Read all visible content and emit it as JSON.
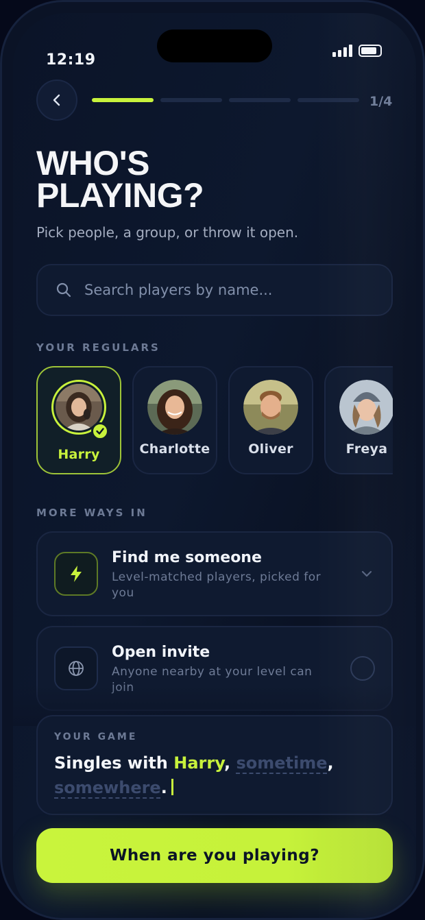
{
  "status_bar": {
    "time": "12:19"
  },
  "header": {
    "step": "1/4",
    "progress_total": 4,
    "progress_current": 1
  },
  "page": {
    "title_line1": "WHO'S",
    "title_line2": "PLAYING?",
    "subtitle": "Pick people, a group, or throw it open."
  },
  "search": {
    "placeholder": "Search players by name..."
  },
  "regulars": {
    "label": "YOUR REGULARS",
    "players": [
      {
        "name": "Harry",
        "selected": true
      },
      {
        "name": "Charlotte",
        "selected": false
      },
      {
        "name": "Oliver",
        "selected": false
      },
      {
        "name": "Freya",
        "selected": false
      }
    ]
  },
  "more_ways": {
    "label": "MORE WAYS IN",
    "options": [
      {
        "title": "Find me someone",
        "description": "Level-matched players, picked for you",
        "icon": "lightning-icon",
        "control": "chevron-down-icon"
      },
      {
        "title": "Open invite",
        "description": "Anyone nearby at your level can join",
        "icon": "globe-icon",
        "control": "radio"
      }
    ]
  },
  "summary": {
    "label": "YOUR GAME",
    "prefix": "Singles with ",
    "player": "Harry",
    "comma1": ", ",
    "when": "sometime",
    "comma2": ",",
    "where": "somewhere",
    "end": "."
  },
  "cta": {
    "label": "When are you playing?"
  },
  "colors": {
    "accent": "#c8f23c",
    "background": "#0b1428",
    "card": "#0f1a30"
  }
}
